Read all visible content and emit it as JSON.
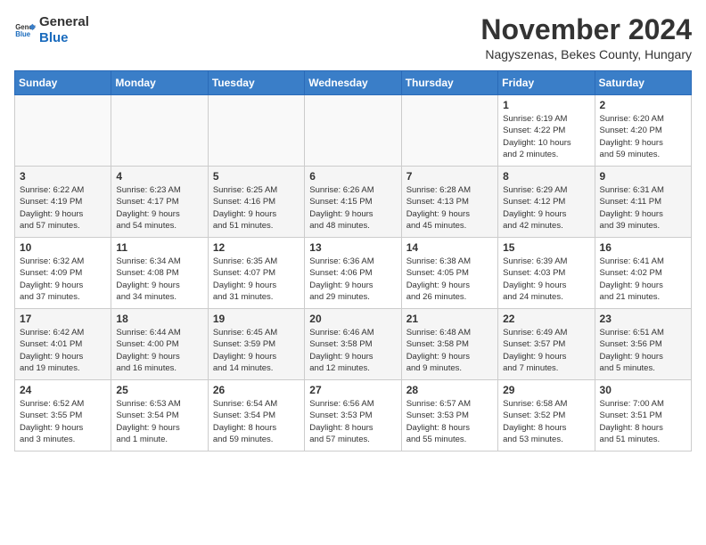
{
  "logo": {
    "general": "General",
    "blue": "Blue"
  },
  "title": "November 2024",
  "subtitle": "Nagyszenas, Bekes County, Hungary",
  "days_header": [
    "Sunday",
    "Monday",
    "Tuesday",
    "Wednesday",
    "Thursday",
    "Friday",
    "Saturday"
  ],
  "weeks": [
    [
      {
        "day": "",
        "info": ""
      },
      {
        "day": "",
        "info": ""
      },
      {
        "day": "",
        "info": ""
      },
      {
        "day": "",
        "info": ""
      },
      {
        "day": "",
        "info": ""
      },
      {
        "day": "1",
        "info": "Sunrise: 6:19 AM\nSunset: 4:22 PM\nDaylight: 10 hours\nand 2 minutes."
      },
      {
        "day": "2",
        "info": "Sunrise: 6:20 AM\nSunset: 4:20 PM\nDaylight: 9 hours\nand 59 minutes."
      }
    ],
    [
      {
        "day": "3",
        "info": "Sunrise: 6:22 AM\nSunset: 4:19 PM\nDaylight: 9 hours\nand 57 minutes."
      },
      {
        "day": "4",
        "info": "Sunrise: 6:23 AM\nSunset: 4:17 PM\nDaylight: 9 hours\nand 54 minutes."
      },
      {
        "day": "5",
        "info": "Sunrise: 6:25 AM\nSunset: 4:16 PM\nDaylight: 9 hours\nand 51 minutes."
      },
      {
        "day": "6",
        "info": "Sunrise: 6:26 AM\nSunset: 4:15 PM\nDaylight: 9 hours\nand 48 minutes."
      },
      {
        "day": "7",
        "info": "Sunrise: 6:28 AM\nSunset: 4:13 PM\nDaylight: 9 hours\nand 45 minutes."
      },
      {
        "day": "8",
        "info": "Sunrise: 6:29 AM\nSunset: 4:12 PM\nDaylight: 9 hours\nand 42 minutes."
      },
      {
        "day": "9",
        "info": "Sunrise: 6:31 AM\nSunset: 4:11 PM\nDaylight: 9 hours\nand 39 minutes."
      }
    ],
    [
      {
        "day": "10",
        "info": "Sunrise: 6:32 AM\nSunset: 4:09 PM\nDaylight: 9 hours\nand 37 minutes."
      },
      {
        "day": "11",
        "info": "Sunrise: 6:34 AM\nSunset: 4:08 PM\nDaylight: 9 hours\nand 34 minutes."
      },
      {
        "day": "12",
        "info": "Sunrise: 6:35 AM\nSunset: 4:07 PM\nDaylight: 9 hours\nand 31 minutes."
      },
      {
        "day": "13",
        "info": "Sunrise: 6:36 AM\nSunset: 4:06 PM\nDaylight: 9 hours\nand 29 minutes."
      },
      {
        "day": "14",
        "info": "Sunrise: 6:38 AM\nSunset: 4:05 PM\nDaylight: 9 hours\nand 26 minutes."
      },
      {
        "day": "15",
        "info": "Sunrise: 6:39 AM\nSunset: 4:03 PM\nDaylight: 9 hours\nand 24 minutes."
      },
      {
        "day": "16",
        "info": "Sunrise: 6:41 AM\nSunset: 4:02 PM\nDaylight: 9 hours\nand 21 minutes."
      }
    ],
    [
      {
        "day": "17",
        "info": "Sunrise: 6:42 AM\nSunset: 4:01 PM\nDaylight: 9 hours\nand 19 minutes."
      },
      {
        "day": "18",
        "info": "Sunrise: 6:44 AM\nSunset: 4:00 PM\nDaylight: 9 hours\nand 16 minutes."
      },
      {
        "day": "19",
        "info": "Sunrise: 6:45 AM\nSunset: 3:59 PM\nDaylight: 9 hours\nand 14 minutes."
      },
      {
        "day": "20",
        "info": "Sunrise: 6:46 AM\nSunset: 3:58 PM\nDaylight: 9 hours\nand 12 minutes."
      },
      {
        "day": "21",
        "info": "Sunrise: 6:48 AM\nSunset: 3:58 PM\nDaylight: 9 hours\nand 9 minutes."
      },
      {
        "day": "22",
        "info": "Sunrise: 6:49 AM\nSunset: 3:57 PM\nDaylight: 9 hours\nand 7 minutes."
      },
      {
        "day": "23",
        "info": "Sunrise: 6:51 AM\nSunset: 3:56 PM\nDaylight: 9 hours\nand 5 minutes."
      }
    ],
    [
      {
        "day": "24",
        "info": "Sunrise: 6:52 AM\nSunset: 3:55 PM\nDaylight: 9 hours\nand 3 minutes."
      },
      {
        "day": "25",
        "info": "Sunrise: 6:53 AM\nSunset: 3:54 PM\nDaylight: 9 hours\nand 1 minute."
      },
      {
        "day": "26",
        "info": "Sunrise: 6:54 AM\nSunset: 3:54 PM\nDaylight: 8 hours\nand 59 minutes."
      },
      {
        "day": "27",
        "info": "Sunrise: 6:56 AM\nSunset: 3:53 PM\nDaylight: 8 hours\nand 57 minutes."
      },
      {
        "day": "28",
        "info": "Sunrise: 6:57 AM\nSunset: 3:53 PM\nDaylight: 8 hours\nand 55 minutes."
      },
      {
        "day": "29",
        "info": "Sunrise: 6:58 AM\nSunset: 3:52 PM\nDaylight: 8 hours\nand 53 minutes."
      },
      {
        "day": "30",
        "info": "Sunrise: 7:00 AM\nSunset: 3:51 PM\nDaylight: 8 hours\nand 51 minutes."
      }
    ]
  ]
}
